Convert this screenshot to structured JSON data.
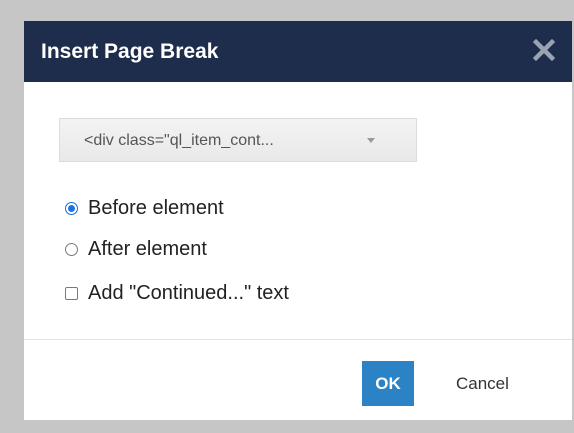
{
  "dialog": {
    "title": "Insert Page Break",
    "close_icon": "close-icon",
    "element_select": {
      "selected": "<div class=\"ql_item_cont...",
      "arrow_icon": "dropdown-arrow-icon"
    },
    "options": [
      {
        "label": "Before element",
        "type": "radio",
        "checked": true
      },
      {
        "label": "After element",
        "type": "radio",
        "checked": false
      },
      {
        "label": "Add \"Continued...\" text",
        "type": "checkbox",
        "checked": false
      }
    ],
    "buttons": {
      "ok": "OK",
      "cancel": "Cancel"
    }
  },
  "colors": {
    "titlebar": "#1e2d4b",
    "primary_button": "#2b83c6",
    "backdrop": "#c6c6c6"
  }
}
